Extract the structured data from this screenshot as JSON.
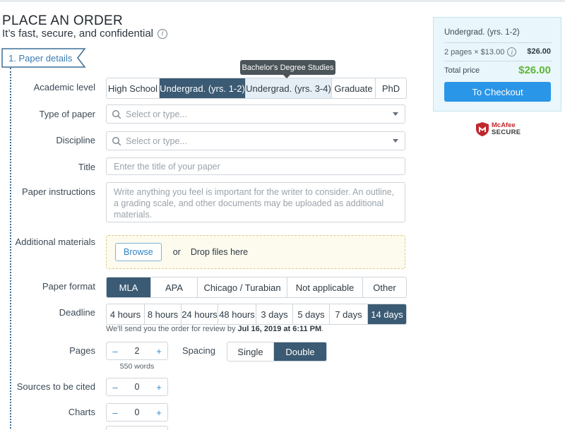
{
  "header": {
    "title": "PLACE AN ORDER",
    "subtitle": "It’s fast, secure, and confidential"
  },
  "step": {
    "label": "1.  Paper details"
  },
  "form": {
    "academic_level": {
      "label": "Academic level",
      "options": [
        "High School",
        "Undergrad. (yrs. 1-2)",
        "Undergrad. (yrs. 3-4)",
        "Graduate",
        "PhD"
      ],
      "selected": "Undergrad. (yrs. 1-2)",
      "tooltip": "Bachelor's Degree Studies"
    },
    "type_of_paper": {
      "label": "Type of paper",
      "placeholder": "Select or type..."
    },
    "discipline": {
      "label": "Discipline",
      "placeholder": "Select or type..."
    },
    "title": {
      "label": "Title",
      "placeholder": "Enter the title of your paper"
    },
    "instructions": {
      "label": "Paper instructions",
      "placeholder": "Write anything you feel is important for the writer to consider. An outline, a grading scale, and other documents may be uploaded as additional materials."
    },
    "materials": {
      "label": "Additional materials",
      "browse": "Browse",
      "or": "or",
      "drop": "Drop files here"
    },
    "paper_format": {
      "label": "Paper format",
      "options": [
        "MLA",
        "APA",
        "Chicago / Turabian",
        "Not applicable",
        "Other"
      ],
      "selected": "MLA"
    },
    "deadline": {
      "label": "Deadline",
      "options": [
        "4 hours",
        "8 hours",
        "24 hours",
        "48 hours",
        "3 days",
        "5 days",
        "7 days",
        "14 days"
      ],
      "selected": "14 days",
      "note_prefix": "We'll send you the order for review by ",
      "note_date": "Jul 16, 2019 at 6:11 PM",
      "note_suffix": "."
    },
    "pages": {
      "label": "Pages",
      "value": "2",
      "words": "550 words",
      "minus": "–",
      "plus": "+"
    },
    "spacing": {
      "label": "Spacing",
      "options": [
        "Single",
        "Double"
      ],
      "selected": "Double"
    },
    "sources": {
      "label": "Sources to be cited",
      "value": "0",
      "minus": "–",
      "plus": "+"
    },
    "charts": {
      "label": "Charts",
      "value": "0",
      "minus": "–",
      "plus": "+"
    }
  },
  "summary": {
    "level": "Undergrad. (yrs. 1-2)",
    "pages_line": "2 pages × $13.00",
    "pages_price": "$26.00",
    "total_label": "Total price",
    "total": "$26.00",
    "checkout": "To Checkout"
  },
  "badge": {
    "line1": "McAfee",
    "line2": "SECURE"
  },
  "colors": {
    "active": "#3b5a73",
    "checkout": "#2a96e8",
    "price": "#5fb735",
    "link": "#2f84c4"
  },
  "icons": [
    "info-icon",
    "search-icon",
    "chevron-down-icon",
    "mcafee-shield-icon"
  ]
}
